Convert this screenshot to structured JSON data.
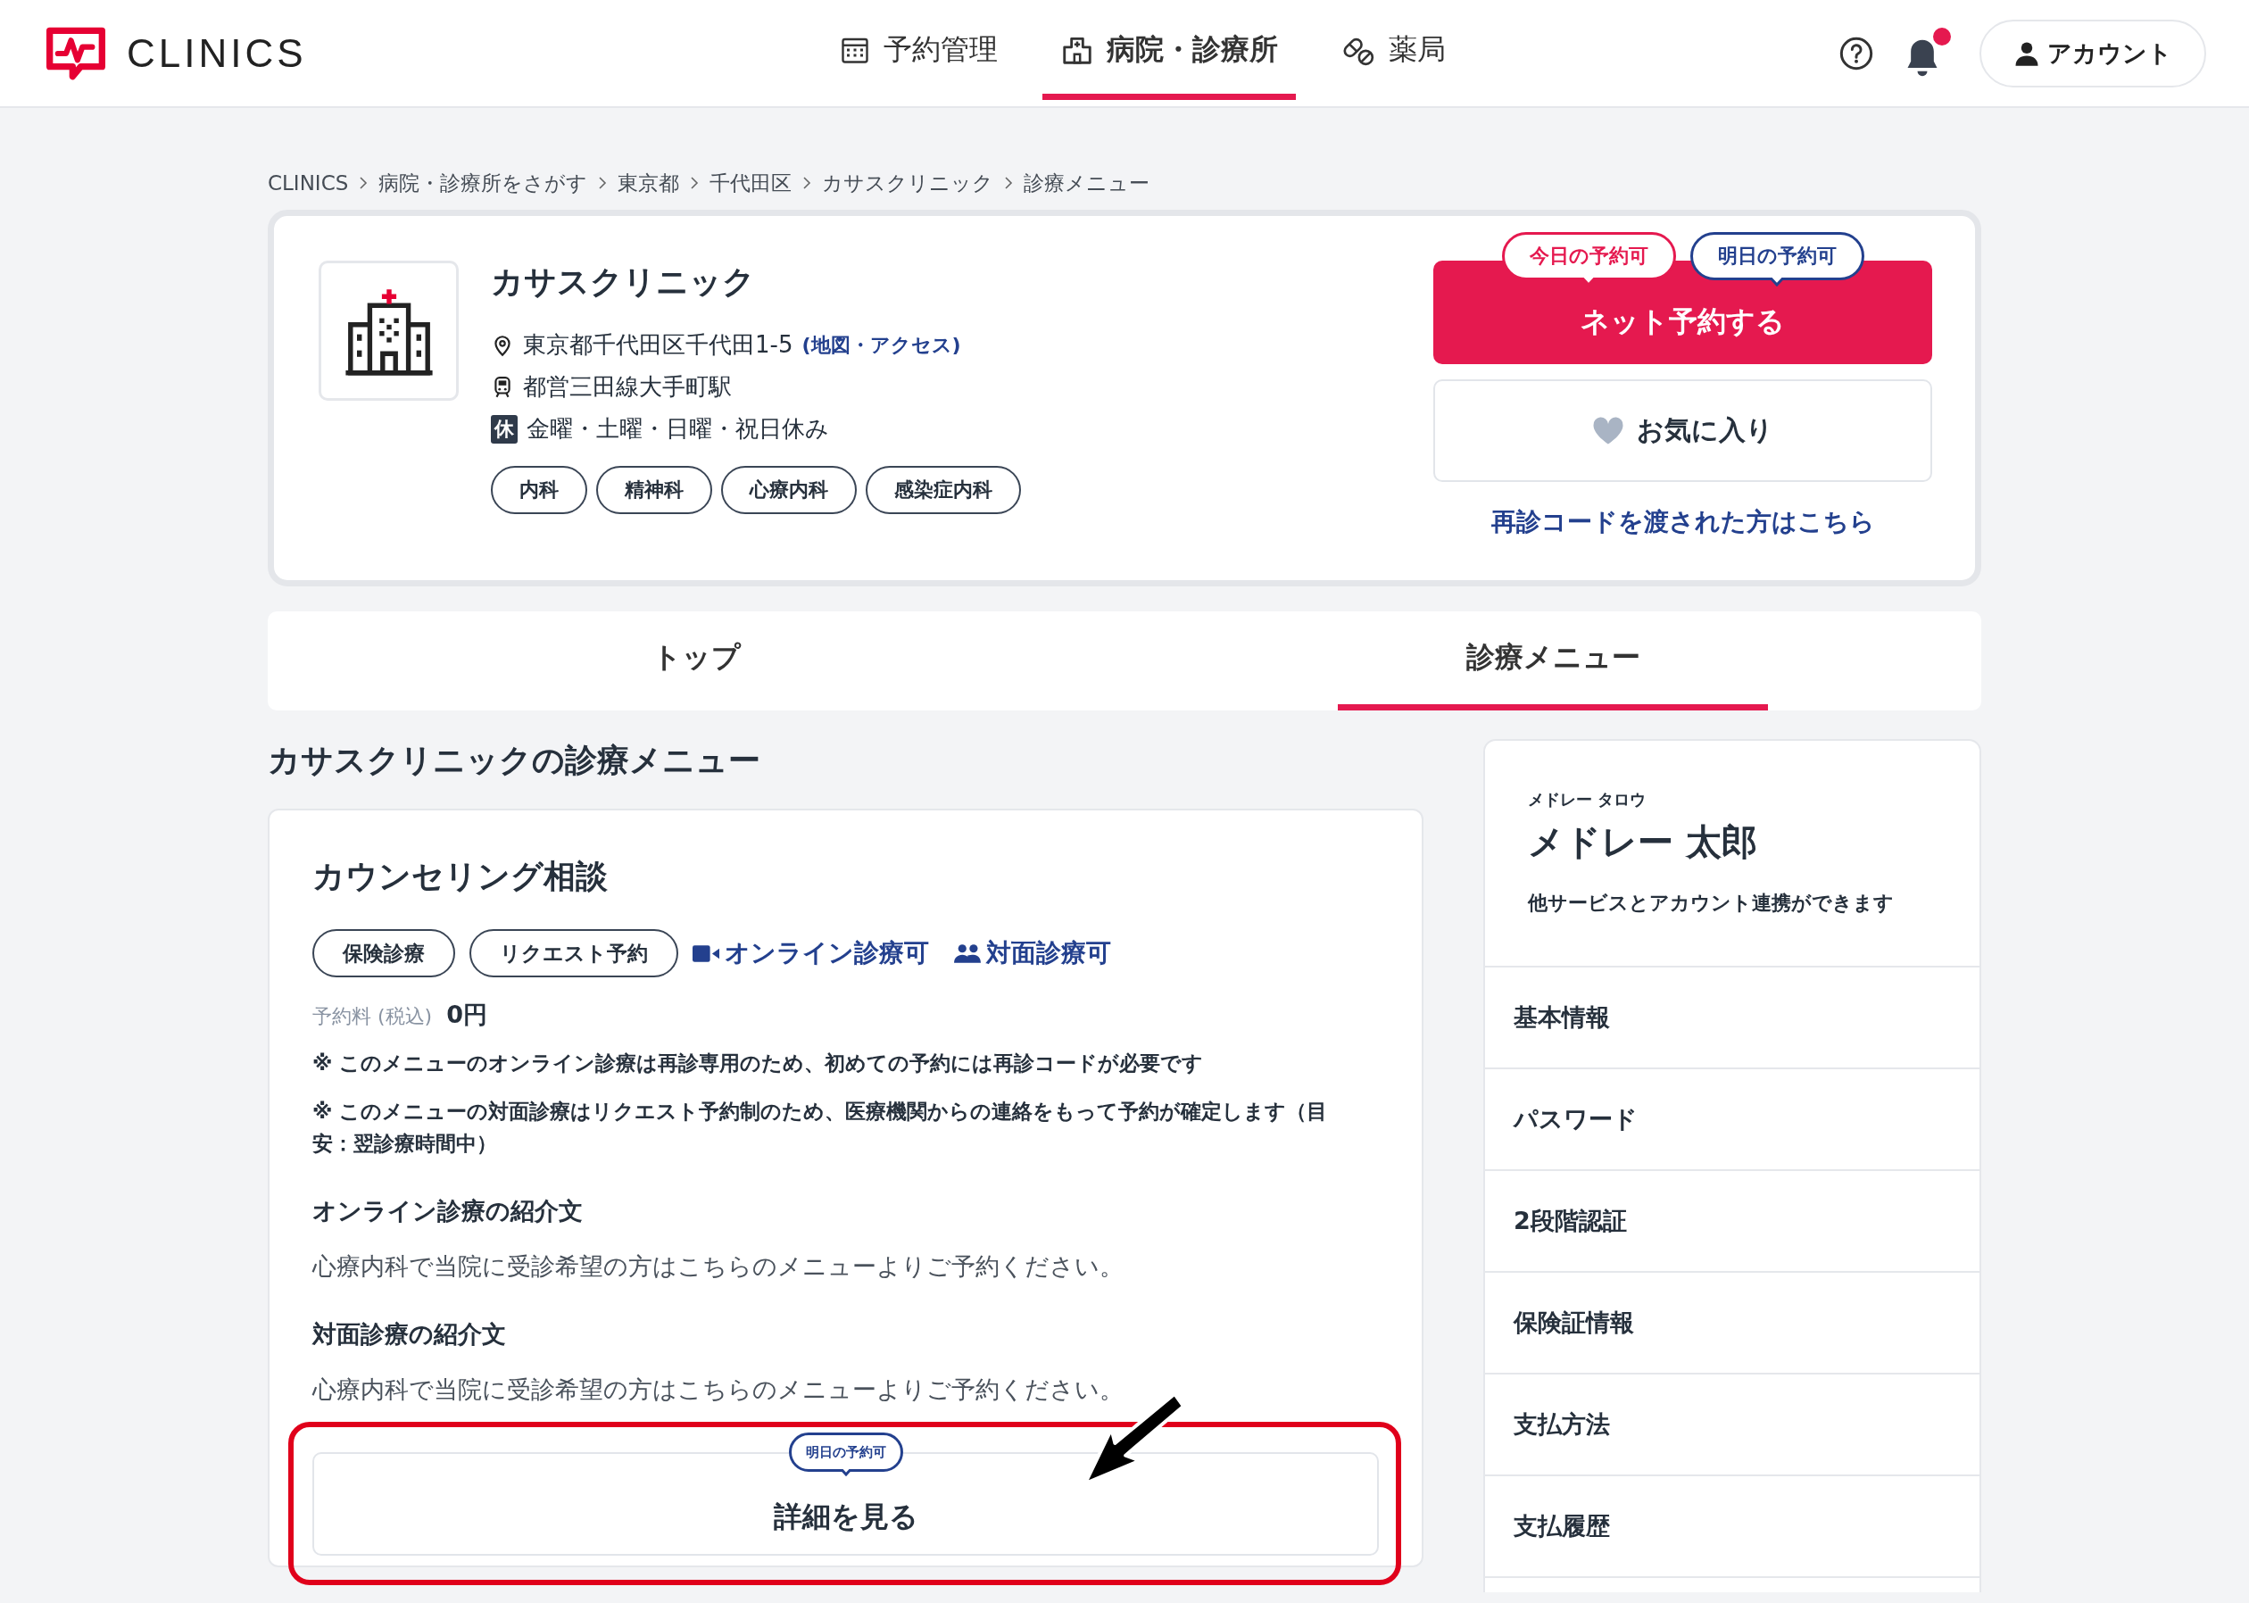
{
  "header": {
    "logo": "CLINICS",
    "nav": [
      {
        "label": "予約管理",
        "kind": "calendar",
        "selected": false
      },
      {
        "label": "病院・診療所",
        "kind": "hospital",
        "selected": true
      },
      {
        "label": "薬局",
        "kind": "pill",
        "selected": false
      }
    ],
    "has_notification": true,
    "account_button": "アカウント"
  },
  "breadcrumb": [
    "CLINICS",
    "病院・診療所をさがす",
    "東京都",
    "千代田区",
    "カサスクリニック",
    "診療メニュー"
  ],
  "clinic": {
    "name": "カサスクリニック",
    "address": "東京都千代田区千代田1-5",
    "map_link": "(地図・アクセス)",
    "station": "都営三田線大手町駅",
    "closed_badge": "休",
    "closed_days": "金曜・土曜・日曜・祝日休み",
    "departments": [
      "内科",
      "精神科",
      "心療内科",
      "感染症内科"
    ],
    "availability": [
      {
        "label": "今日の予約可",
        "kind": "today"
      },
      {
        "label": "明日の予約可",
        "kind": "tomorrow"
      }
    ],
    "reserve_button": "ネット予約する",
    "favorite_button": "お気に入り",
    "revisit_link": "再診コードを渡された方はこちら"
  },
  "tabs": [
    {
      "label": "トップ",
      "selected": false
    },
    {
      "label": "診療メニュー",
      "selected": true
    }
  ],
  "section_title": "カサスクリニックの診療メニュー",
  "menu": {
    "title": "カウンセリング相談",
    "tags": [
      "保険診療",
      "リクエスト予約"
    ],
    "modes": [
      {
        "label": "オンライン診療可",
        "kind": "online"
      },
      {
        "label": "対面診療可",
        "kind": "in_person"
      }
    ],
    "fee_label": "予約料 (税込)",
    "fee": "0円",
    "notes": [
      "※ このメニューのオンライン診療は再診専用のため、初めての予約には再診コードが必要です",
      "※ このメニューの対面診療はリクエスト予約制のため、医療機関からの連絡をもって予約が確定します（目安：翌診療時間中）"
    ],
    "sections": [
      {
        "heading": "オンライン診療の紹介文",
        "text": "心療内科で当院に受診希望の方はこちらのメニューよりご予約ください。"
      },
      {
        "heading": "対面診療の紹介文",
        "text": "心療内科で当院に受診希望の方はこちらのメニューよりご予約ください。"
      }
    ],
    "availability": "明日の予約可",
    "detail_button": "詳細を見る"
  },
  "account": {
    "name_kana": "メドレー タロウ",
    "name": "メドレー 太郎",
    "subtitle": "他サービスとアカウント連携ができます",
    "items": [
      "基本情報",
      "パスワード",
      "2段階認証",
      "保険証情報",
      "支払方法",
      "支払履歴"
    ]
  }
}
